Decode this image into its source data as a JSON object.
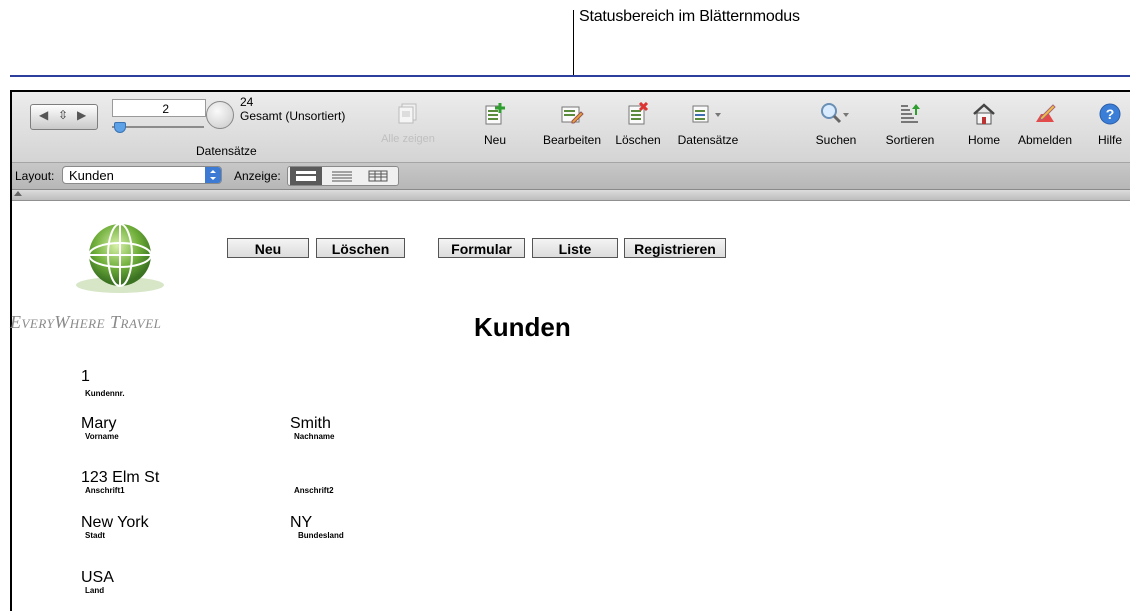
{
  "annotation": {
    "callout": "Statusbereich im Blätternmodus"
  },
  "status": {
    "record_number": "2",
    "total_count": "24",
    "total_label": "Gesamt (Unsortiert)",
    "records_label": "Datensätze"
  },
  "toolbar": {
    "show_all": "Alle zeigen",
    "new": "Neu",
    "edit": "Bearbeiten",
    "delete": "Löschen",
    "records": "Datensätze",
    "find": "Suchen",
    "sort": "Sortieren",
    "home": "Home",
    "logout": "Abmelden",
    "help": "Hilfe"
  },
  "layoutbar": {
    "layout_label": "Layout:",
    "layout_value": "Kunden",
    "view_label": "Anzeige:"
  },
  "logo": {
    "brand": "EveryWhere Travel"
  },
  "buttons": {
    "new": "Neu",
    "delete": "Löschen",
    "form": "Formular",
    "list": "Liste",
    "register": "Registrieren"
  },
  "page_title": "Kunden",
  "record": {
    "customer_no": {
      "value": "1",
      "label": "Kundennr."
    },
    "first_name": {
      "value": "Mary",
      "label": "Vorname"
    },
    "last_name": {
      "value": "Smith",
      "label": "Nachname"
    },
    "address1": {
      "value": "123 Elm St",
      "label": "Anschrift1"
    },
    "address2": {
      "value": "",
      "label": "Anschrift2"
    },
    "city": {
      "value": "New York",
      "label": "Stadt"
    },
    "state": {
      "value": "NY",
      "label": "Bundesland"
    },
    "country": {
      "value": "USA",
      "label": "Land"
    }
  }
}
